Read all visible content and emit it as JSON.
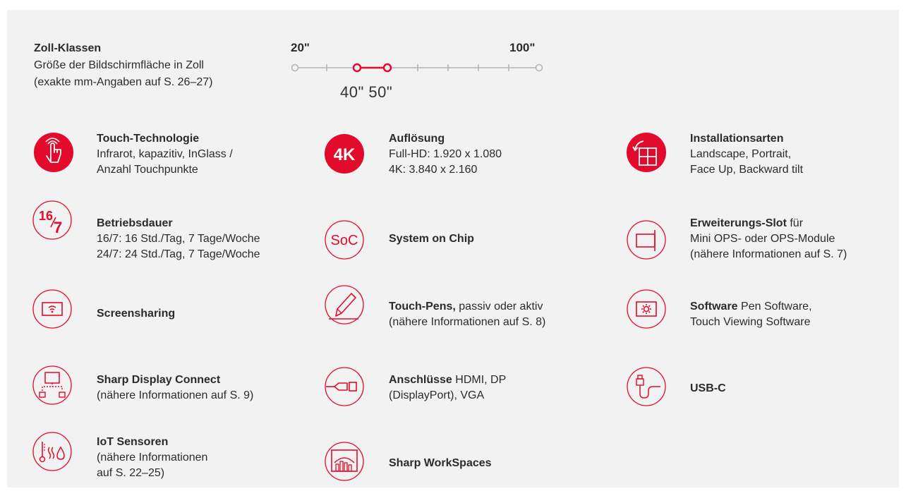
{
  "zoll": {
    "title": "Zoll-Klassen",
    "line1": "Größe der Bildschirmfläche in Zoll",
    "line2": "(exakte mm-Angaben auf S. 26–27)",
    "min_label": "20\"",
    "max_label": "100\"",
    "selected_values": "40\" 50\""
  },
  "items": {
    "touch": {
      "title": "Touch-Technologie",
      "l1": "Infrarot, kapazitiv, InGlass /",
      "l2": "Anzahl Touchpunkte"
    },
    "aufl": {
      "badge": "4K",
      "title": "Auflösung",
      "l1": "Full-HD: 1.920 x 1.080",
      "l2": "4K: 3.840 x 2.160"
    },
    "install": {
      "title": "Installationsarten",
      "l1": "Landscape, Portrait,",
      "l2": "Face Up, Backward tilt"
    },
    "betrieb": {
      "icon_text_a": "16",
      "icon_text_b": "7",
      "title": "Betriebsdauer",
      "l1": "16/7: 16 Std./Tag, 7 Tage/Woche",
      "l2": "24/7: 24 Std./Tag, 7 Tage/Woche"
    },
    "soc": {
      "icon_text": "SoC",
      "title": "System on Chip"
    },
    "slot": {
      "title": "Erweiterungs-Slot",
      "title_rest": " für",
      "l1": "Mini OPS- oder OPS-Module",
      "l2": "(nähere Informationen auf S. 7)"
    },
    "screen": {
      "title": "Screensharing"
    },
    "pens": {
      "title": "Touch-Pens,",
      "title_rest": " passiv oder aktiv",
      "l1": "(nähere Informationen auf S. 8)"
    },
    "software": {
      "title": "Software",
      "title_rest": " Pen Software,",
      "l1": "Touch Viewing Software"
    },
    "sdc": {
      "title": "Sharp Display Connect",
      "l1": "(nähere Informationen auf S. 9)"
    },
    "ansch": {
      "title": "Anschlüsse",
      "title_rest": " HDMI, DP",
      "l1": "(DisplayPort), VGA"
    },
    "usbc": {
      "title": "USB-C"
    },
    "iot": {
      "title": "IoT Sensoren",
      "l1": "(nähere Informationen",
      "l2": "auf S. 22–25)"
    },
    "workspaces": {
      "title": "Sharp WorkSpaces"
    }
  },
  "colors": {
    "accent": "#e30b2c",
    "panel": "#f2f2f2",
    "text": "#2b2b2b"
  }
}
